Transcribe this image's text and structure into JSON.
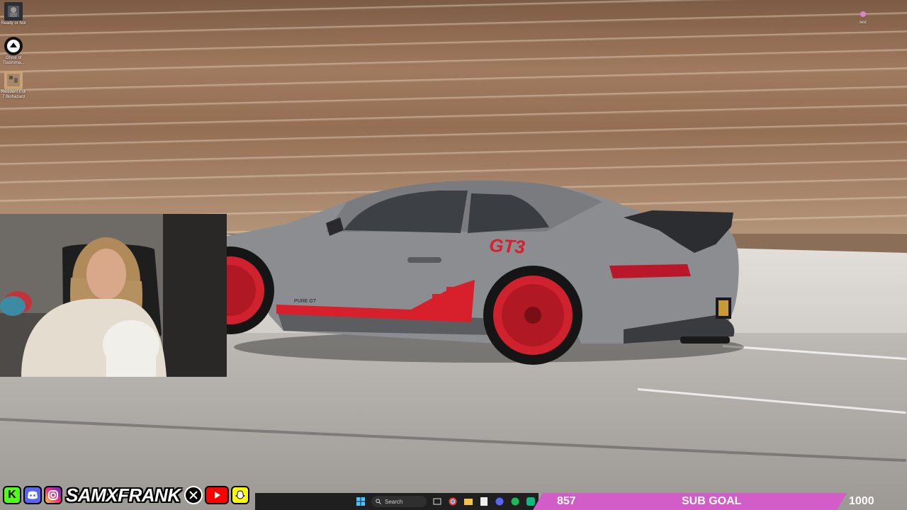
{
  "desktop": {
    "icons": [
      {
        "label": "Ready or Not",
        "icon": "ready-or-not-icon"
      },
      {
        "label": "Ghost of Tsushima...",
        "icon": "ghost-of-tsushima-icon"
      },
      {
        "label": "Resident Evil 7 Biohazard",
        "icon": "resident-evil-icon"
      },
      {
        "label": "test",
        "icon": "test-icon"
      }
    ]
  },
  "car": {
    "badge": "GT3",
    "brand_decal": "PURE GT"
  },
  "social": {
    "name": "SAMXFRANK",
    "icons": [
      "kick-icon",
      "discord-icon",
      "instagram-icon",
      "x-icon",
      "youtube-icon",
      "snapchat-icon"
    ]
  },
  "taskbar": {
    "search_placeholder": "Search"
  },
  "sub_goal": {
    "current": "857",
    "label": "SUB GOAL",
    "target": "1000",
    "progress": 0.857
  },
  "colors": {
    "subgoal": "#d25cc8",
    "car_red": "#d8202c",
    "car_grey": "#8c8d90"
  }
}
